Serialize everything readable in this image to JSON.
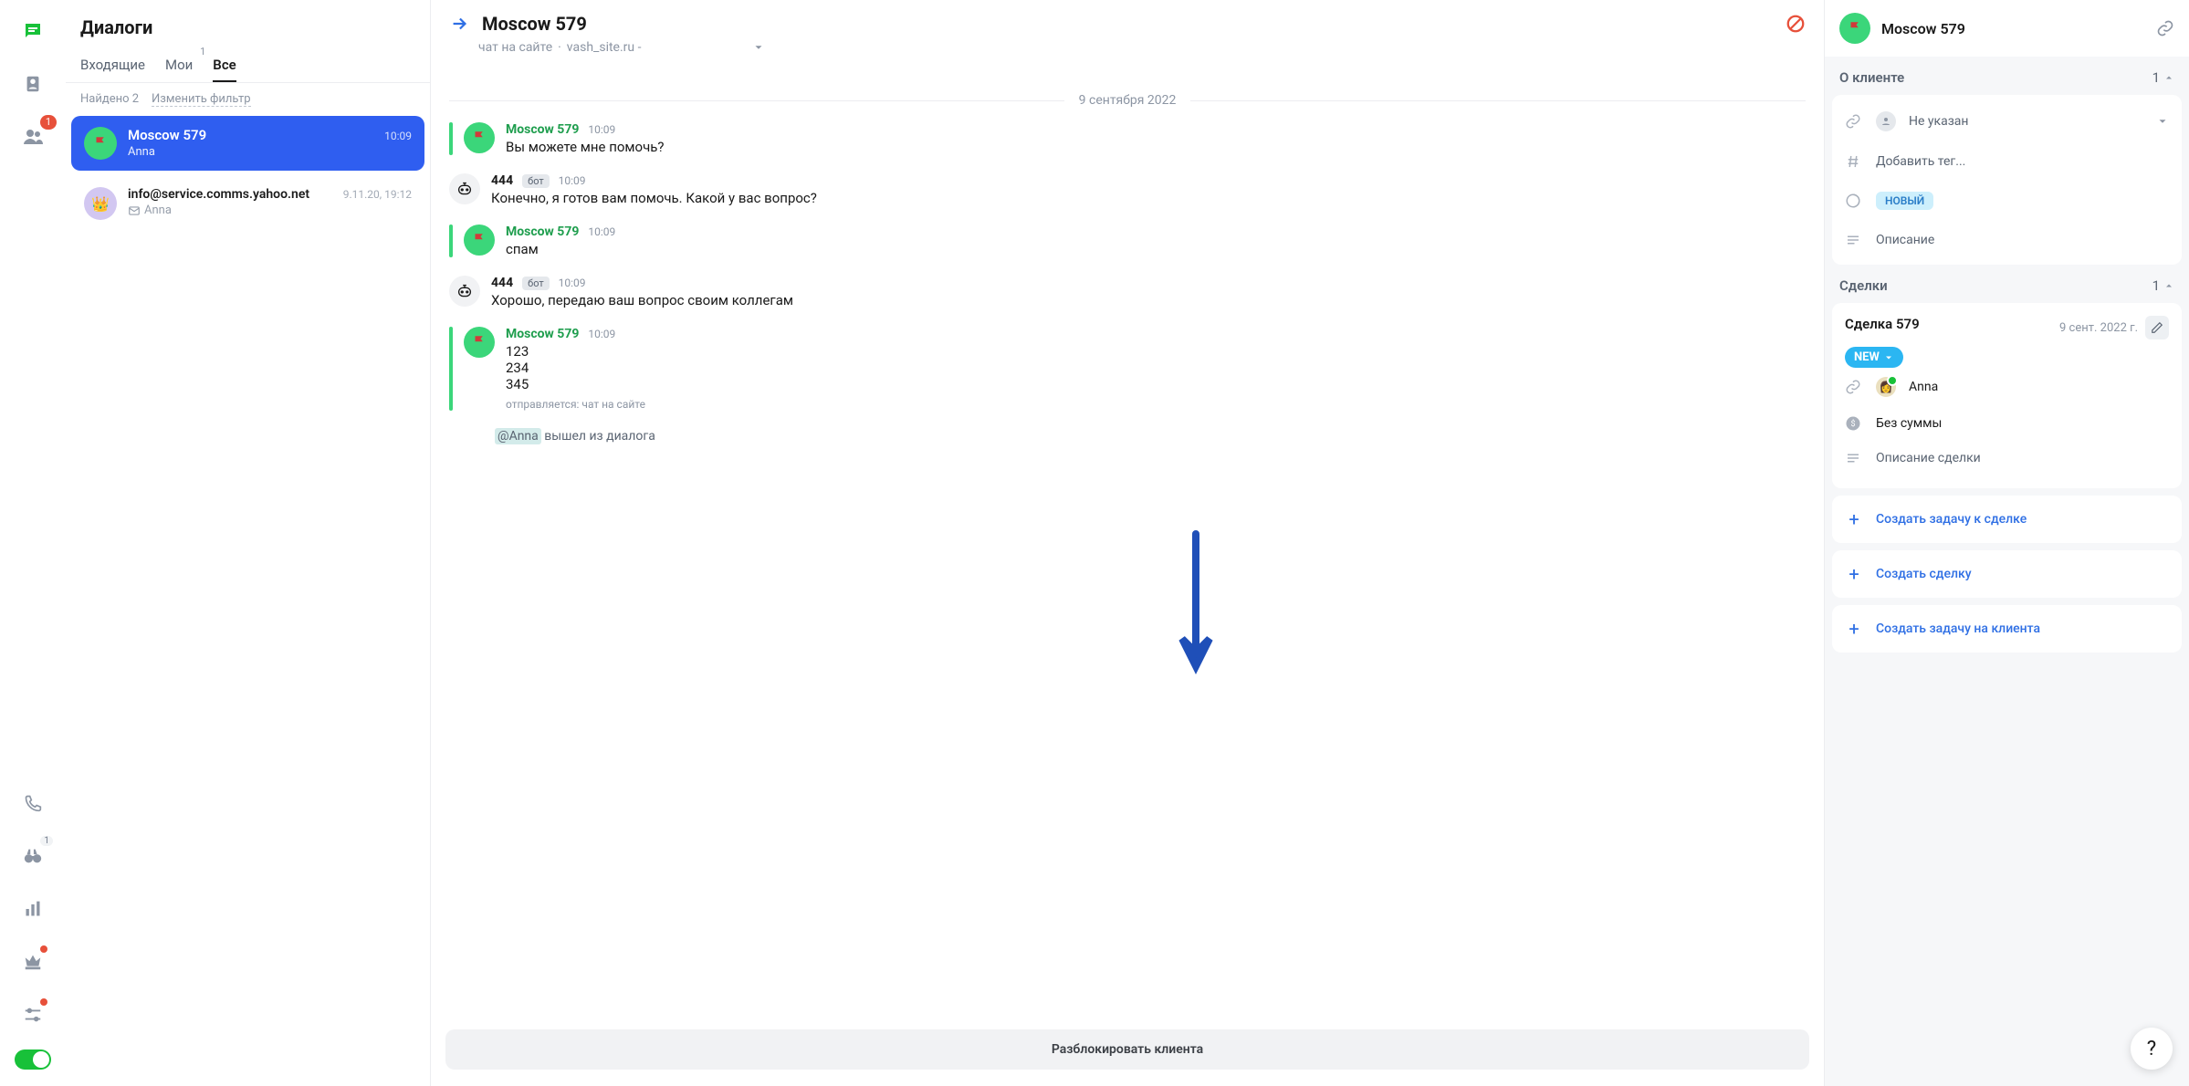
{
  "dialogs": {
    "title": "Диалоги",
    "tabs": [
      {
        "label": "Входящие",
        "badge": null
      },
      {
        "label": "Мои",
        "badge": "1"
      },
      {
        "label": "Все",
        "badge": null
      }
    ],
    "filter_found": "Найдено 2",
    "filter_edit": "Изменить фильтр",
    "items": [
      {
        "name": "Moscow 579",
        "preview": "Anna",
        "time": "10:09",
        "selected": true,
        "icon": "flag"
      },
      {
        "name": "info@service.comms.yahoo.net",
        "preview": "Anna",
        "time": "9.11.20, 19:12",
        "selected": false,
        "icon": "crown"
      }
    ]
  },
  "navrail": {
    "contacts_badge": "1",
    "binoculars_badge": "1"
  },
  "chat": {
    "title": "Moscow 579",
    "subheader_source": "чат на сайте",
    "subheader_site": "vash_site.ru -",
    "date_separator": "9 сентября 2022",
    "messages": [
      {
        "type": "user",
        "author": "Moscow 579",
        "time": "10:09",
        "text": "Вы можете мне помочь?"
      },
      {
        "type": "bot",
        "author": "444",
        "bot_label": "бот",
        "time": "10:09",
        "text": "Конечно, я готов вам помочь. Какой у вас вопрос?"
      },
      {
        "type": "user",
        "author": "Moscow 579",
        "time": "10:09",
        "text": "спам"
      },
      {
        "type": "bot",
        "author": "444",
        "bot_label": "бот",
        "time": "10:09",
        "text": "Хорошо, передаю ваш вопрос своим коллегам"
      },
      {
        "type": "user",
        "author": "Moscow 579",
        "time": "10:09",
        "text": "123\n234\n345",
        "fine": "отправляется: чат на сайте"
      }
    ],
    "system_mention": "@Anna",
    "system_tail": " вышел из диалога",
    "unblock_button": "Разблокировать клиента"
  },
  "client": {
    "name": "Moscow 579",
    "section_about": "О клиенте",
    "about_count": "1",
    "operator_unset": "Не указан",
    "add_tag": "Добавить тег...",
    "status_new": "НОВЫЙ",
    "description": "Описание",
    "section_deals": "Сделки",
    "deals_count": "1",
    "deal": {
      "title": "Сделка 579",
      "date": "9 сент. 2022 г.",
      "stage": "NEW",
      "assignee": "Anna",
      "amount": "Без суммы",
      "desc": "Описание сделки"
    },
    "actions": {
      "task_deal": "Создать задачу к сделке",
      "new_deal": "Создать сделку",
      "task_client": "Создать задачу на клиента"
    }
  },
  "help_fab": "?"
}
